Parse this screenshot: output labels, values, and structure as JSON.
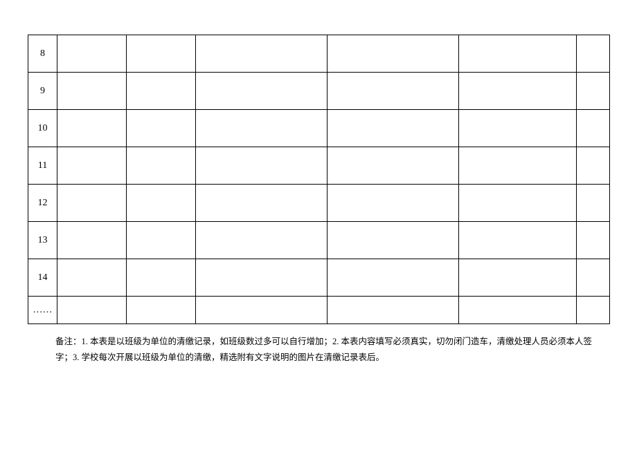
{
  "table": {
    "rows": [
      {
        "idx": "8",
        "c1": "",
        "c2": "",
        "c3": "",
        "c4": "",
        "c5": "",
        "c6": ""
      },
      {
        "idx": "9",
        "c1": "",
        "c2": "",
        "c3": "",
        "c4": "",
        "c5": "",
        "c6": ""
      },
      {
        "idx": "10",
        "c1": "",
        "c2": "",
        "c3": "",
        "c4": "",
        "c5": "",
        "c6": ""
      },
      {
        "idx": "11",
        "c1": "",
        "c2": "",
        "c3": "",
        "c4": "",
        "c5": "",
        "c6": ""
      },
      {
        "idx": "12",
        "c1": "",
        "c2": "",
        "c3": "",
        "c4": "",
        "c5": "",
        "c6": ""
      },
      {
        "idx": "13",
        "c1": "",
        "c2": "",
        "c3": "",
        "c4": "",
        "c5": "",
        "c6": ""
      },
      {
        "idx": "14",
        "c1": "",
        "c2": "",
        "c3": "",
        "c4": "",
        "c5": "",
        "c6": ""
      },
      {
        "idx": "……",
        "c1": "",
        "c2": "",
        "c3": "",
        "c4": "",
        "c5": "",
        "c6": ""
      }
    ]
  },
  "note": "备注：1. 本表是以班级为单位的清缴记录，如班级数过多可以自行增加；2. 本表内容填写必须真实，切勿闭门造车，清缴处理人员必须本人签字；3. 学校每次开展以班级为单位的清缴，精选附有文字说明的图片在清缴记录表后。"
}
